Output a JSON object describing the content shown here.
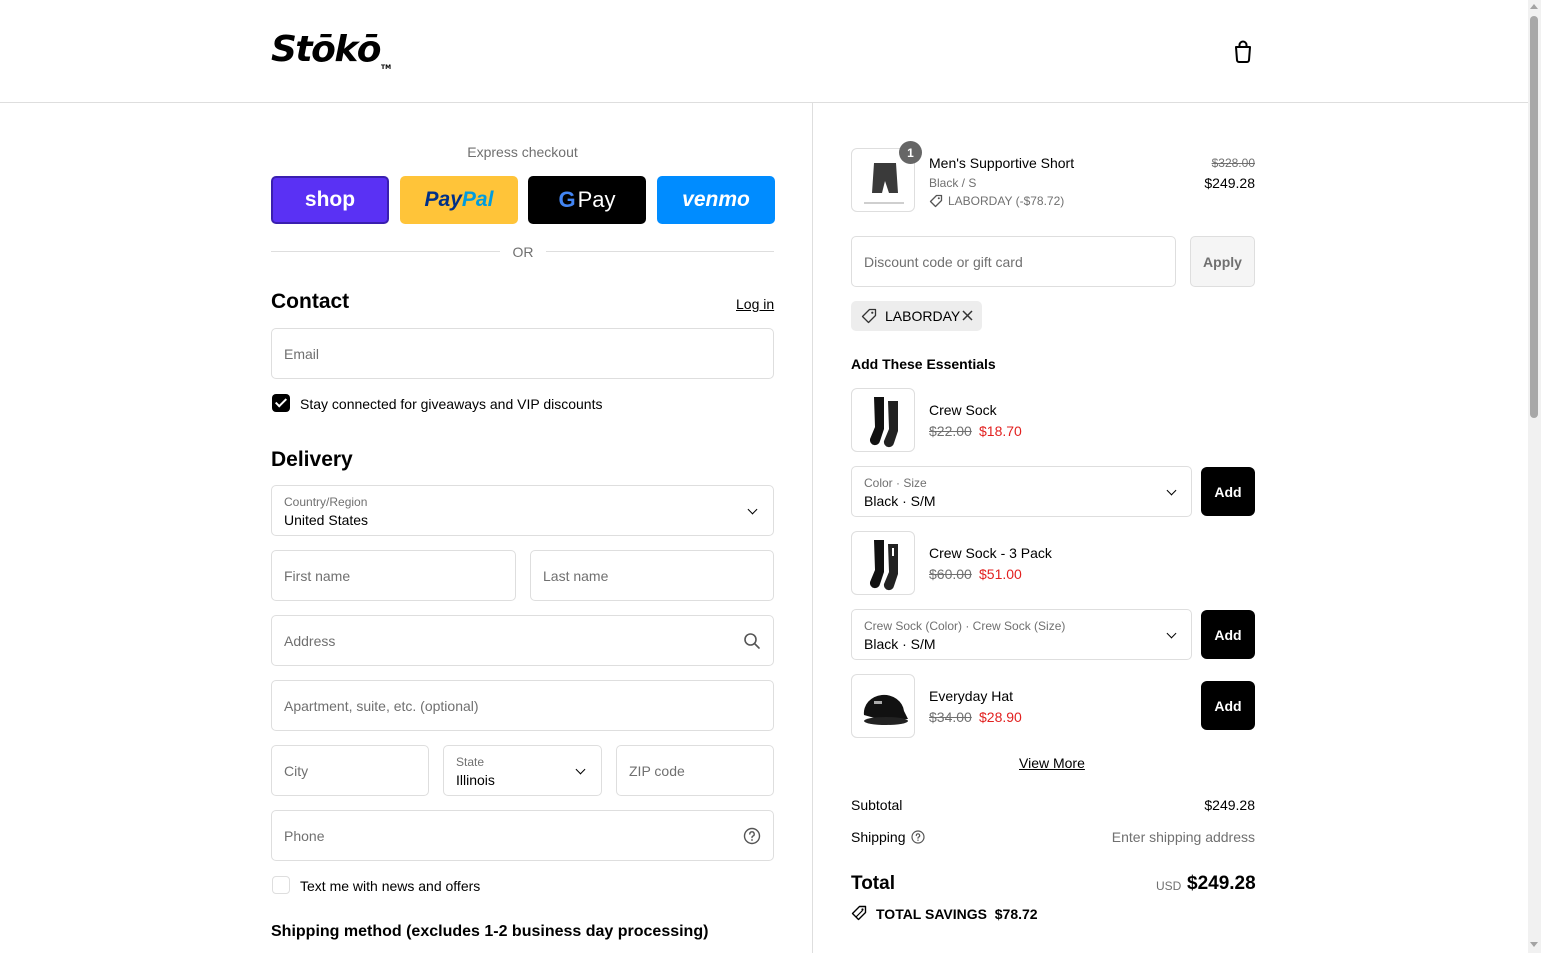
{
  "header": {
    "logo": "Stōkō",
    "logo_tm": "TM"
  },
  "express": {
    "label": "Express checkout",
    "shop": "shop",
    "paypal_a": "Pay",
    "paypal_b": "Pal",
    "gpay_g": "G",
    "gpay_text": "Pay",
    "venmo": "venmo",
    "or": "OR"
  },
  "contact": {
    "title": "Contact",
    "login": "Log in",
    "email_placeholder": "Email",
    "newsletter_label": "Stay connected for giveaways and VIP discounts",
    "newsletter_checked": true
  },
  "delivery": {
    "title": "Delivery",
    "country_label": "Country/Region",
    "country_value": "United States",
    "first_name": "First name",
    "last_name": "Last name",
    "address": "Address",
    "apartment": "Apartment, suite, etc. (optional)",
    "city": "City",
    "state_label": "State",
    "state_value": "Illinois",
    "zip": "ZIP code",
    "phone": "Phone",
    "sms_label": "Text me with news and offers",
    "sms_checked": false
  },
  "shipping_method": {
    "title": "Shipping method (excludes 1-2 business day processing)"
  },
  "order": {
    "item": {
      "qty": "1",
      "name": "Men's Supportive Short",
      "variant": "Black / S",
      "discount": "LABORDAY (-$78.72)",
      "original_price": "$328.00",
      "price": "$249.28"
    },
    "discount_placeholder": "Discount code or gift card",
    "apply": "Apply",
    "applied_code": "LABORDAY"
  },
  "essentials": {
    "title": "Add These Essentials",
    "items": [
      {
        "name": "Crew Sock",
        "original_price": "$22.00",
        "sale_price": "$18.70",
        "select_label": "Color · Size",
        "select_value": "Black · S/M",
        "add": "Add"
      },
      {
        "name": "Crew Sock - 3 Pack",
        "original_price": "$60.00",
        "sale_price": "$51.00",
        "select_label": "Crew Sock (Color) · Crew Sock (Size)",
        "select_value": "Black · S/M",
        "add": "Add"
      },
      {
        "name": "Everyday Hat",
        "original_price": "$34.00",
        "sale_price": "$28.90",
        "add": "Add"
      }
    ],
    "view_more": "View More"
  },
  "summary": {
    "subtotal_label": "Subtotal",
    "subtotal_value": "$249.28",
    "shipping_label": "Shipping",
    "shipping_value": "Enter shipping address",
    "total_label": "Total",
    "currency": "USD",
    "total_value": "$249.28",
    "savings_label": "TOTAL SAVINGS",
    "savings_value": "$78.72"
  },
  "colors": {
    "shop": "#5a31f4",
    "paypal": "#ffc439",
    "venmo": "#008cff",
    "sale_red": "#e22120",
    "border": "#dedede"
  }
}
